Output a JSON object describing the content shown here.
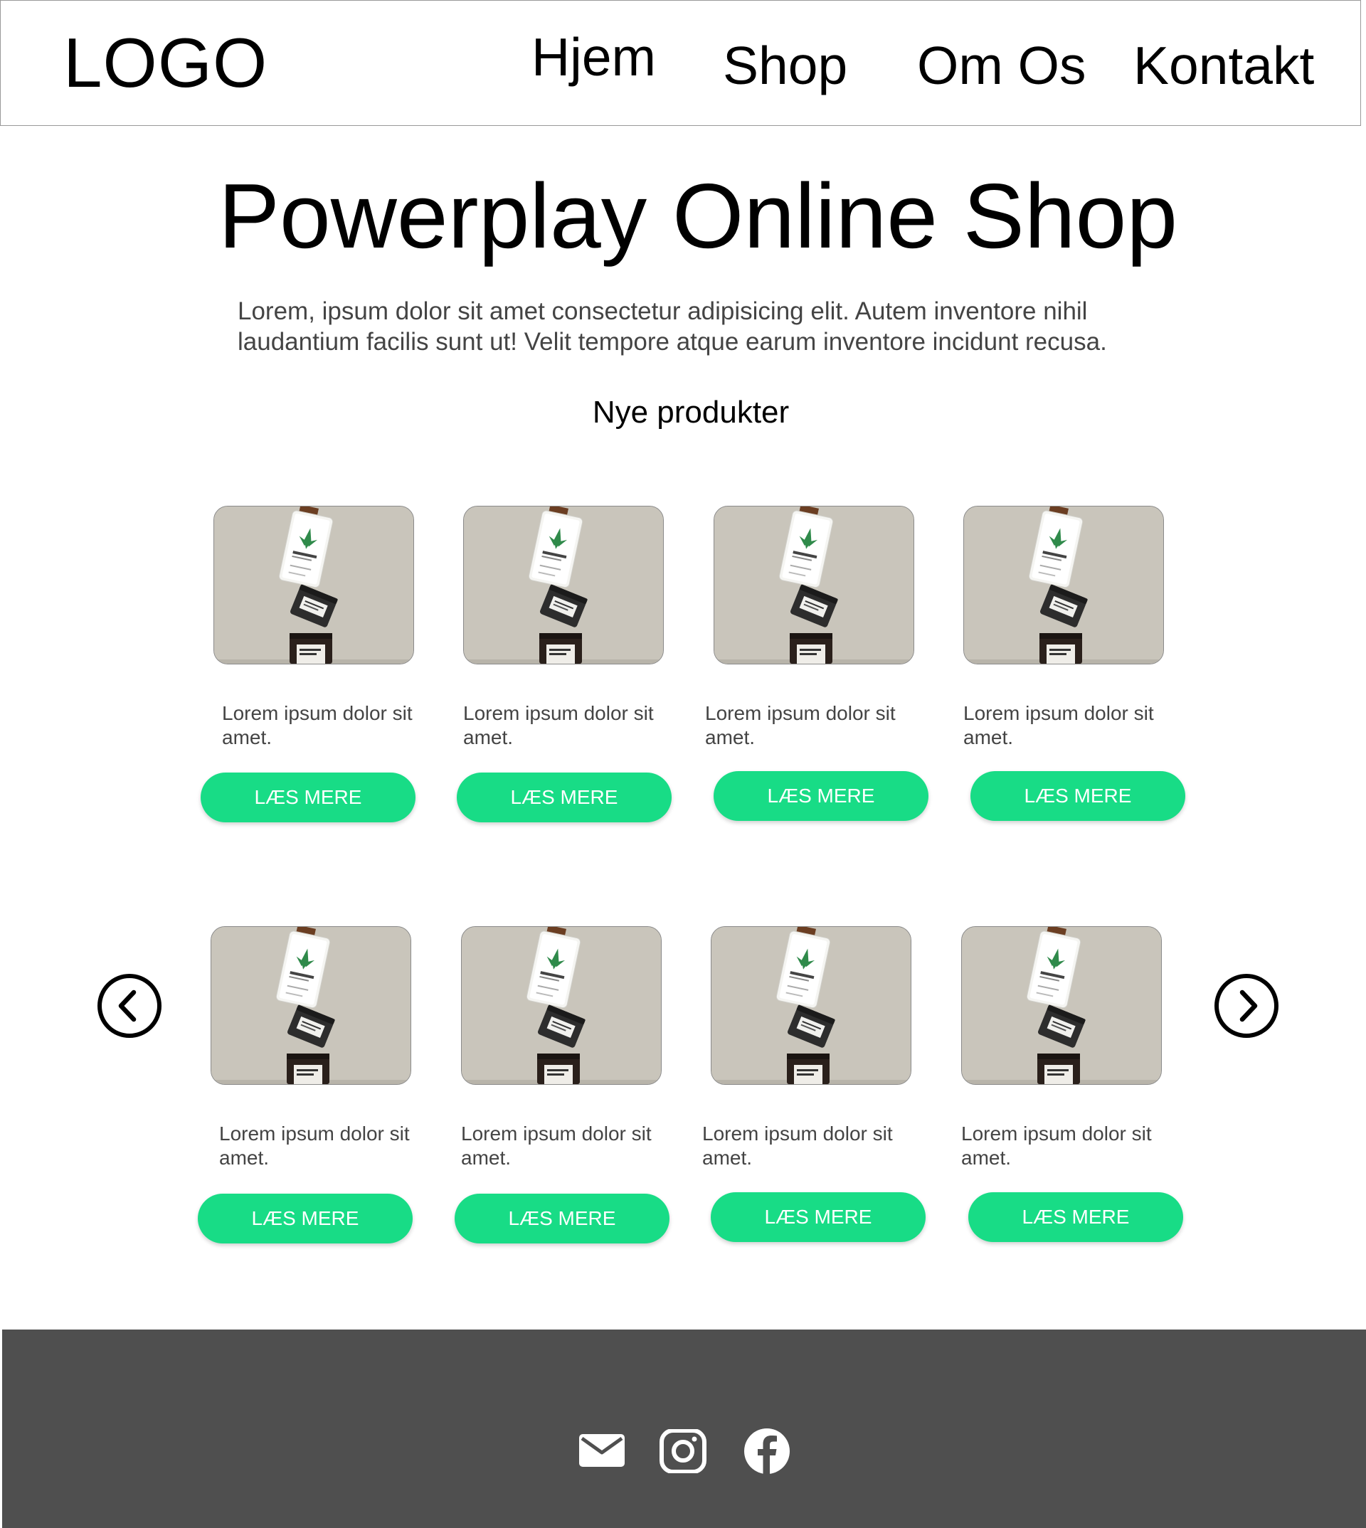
{
  "header": {
    "logo": "LOGO",
    "nav": [
      "Hjem",
      "Shop",
      "Om Os",
      "Kontakt"
    ]
  },
  "hero": {
    "title": "Powerplay Online Shop",
    "description": "Lorem, ipsum dolor sit amet consectetur adipisicing elit. Autem inventore nihil laudantium facilis sunt ut! Velit tempore atque earum inventore incidunt recusa."
  },
  "products_section": {
    "title": "Nye produkter",
    "products": [
      {
        "text": "Lorem ipsum dolor sit amet.",
        "button": "LÆS MERE"
      },
      {
        "text": "Lorem ipsum dolor sit amet.",
        "button": "LÆS MERE"
      },
      {
        "text": "Lorem ipsum dolor sit amet.",
        "button": "LÆS MERE"
      },
      {
        "text": "Lorem ipsum dolor sit amet.",
        "button": "LÆS MERE"
      },
      {
        "text": "Lorem ipsum dolor sit amet.",
        "button": "LÆS MERE"
      },
      {
        "text": "Lorem ipsum dolor sit amet.",
        "button": "LÆS MERE"
      },
      {
        "text": "Lorem ipsum dolor sit amet.",
        "button": "LÆS MERE"
      },
      {
        "text": "Lorem ipsum dolor sit amet.",
        "button": "LÆS MERE"
      }
    ],
    "carousel_icons": [
      "chevron-left-icon",
      "chevron-right-icon"
    ]
  },
  "footer": {
    "icons": [
      "mail-icon",
      "instagram-icon",
      "facebook-icon"
    ]
  },
  "colors": {
    "accent": "#18dc86",
    "footer_bg": "#4f4f4f",
    "product_bg": "#c9c5bb"
  }
}
